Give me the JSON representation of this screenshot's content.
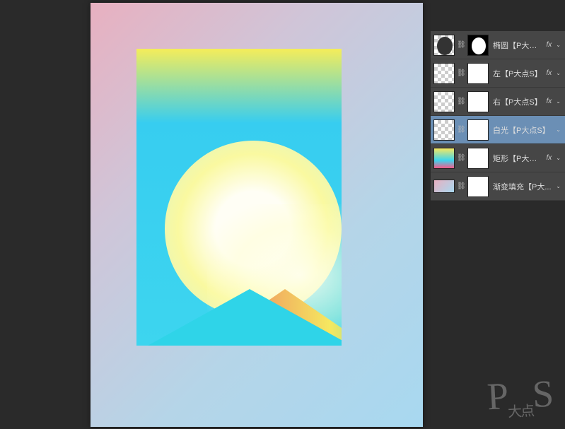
{
  "layers": [
    {
      "name": "椭圆【P大点S...",
      "hasFx": true,
      "selected": false,
      "thumbType": "checker ellipse",
      "maskType": "black-ellipse"
    },
    {
      "name": "左【P大点S】",
      "hasFx": true,
      "selected": false,
      "thumbType": "checker",
      "maskType": "white"
    },
    {
      "name": "右【P大点S】",
      "hasFx": true,
      "selected": false,
      "thumbType": "checker",
      "maskType": "white"
    },
    {
      "name": "白光【P大点S】",
      "hasFx": false,
      "selected": true,
      "thumbType": "checker",
      "maskType": "white"
    },
    {
      "name": "矩形【P大点S】",
      "hasFx": true,
      "selected": false,
      "thumbType": "mainart",
      "maskType": "white"
    },
    {
      "name": "渐变填充【P大...",
      "hasFx": false,
      "selected": false,
      "thumbType": "pink-grad small",
      "maskType": "white"
    }
  ],
  "fxLabel": "fx",
  "watermark": {
    "main": "P",
    "sub": "大点",
    "tail": "S"
  }
}
